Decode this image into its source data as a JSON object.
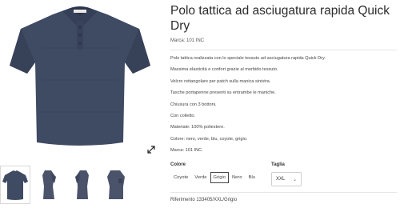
{
  "product": {
    "title": "Polo tattica ad asciugatura rapida Quick Dry",
    "brand": "Marca: 101 INC",
    "description": [
      "Polo tattica realizzata con lo speciale tessuto ad asciugatura rapida Quick Dry.",
      "Massima elasticità e confort grazie al morbido tessuto.",
      "Velcro rettangolare per patch sulla manica sinistra.",
      "Tasche portapenne presenti su entrambe le maniche.",
      "Chiusura con 3 bottoni.",
      "Con colletto.",
      "Materiale: 100% poliestere.",
      "Colore: nero, verde, blu, coyote, grigio.",
      "Marca: 101 INC."
    ]
  },
  "images": {
    "shirt_color": "#3f4a63",
    "shirt_shadow": "#343e55",
    "thumbnails": [
      "front",
      "side-left",
      "side-right",
      "sleeve-patch"
    ],
    "zoom_icon": "expand-icon"
  },
  "options": {
    "colore_label": "Colore",
    "colors": [
      "Coyote",
      "Verde",
      "Grigio",
      "Nero",
      "Blu"
    ],
    "selected_color": "Grigio",
    "taglia_label": "Taglia",
    "size_value": "XXL"
  },
  "reference": "Riferimento 133405/XXL/Grigio"
}
